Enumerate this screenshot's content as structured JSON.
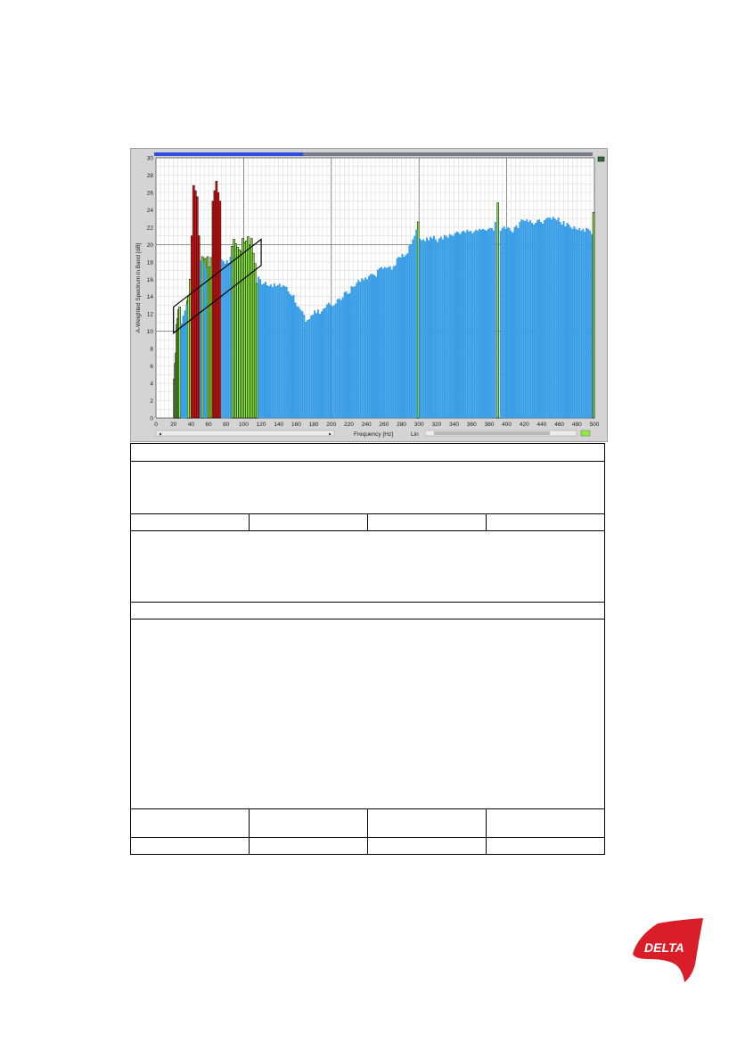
{
  "window": {
    "progress": 0.34,
    "scroll_left_arrow": "◂",
    "scroll_right_arrow": "▸",
    "scale_mode": "Lin",
    "colors": {
      "progress_fill": "#2c4ee0",
      "progress_track": "#7a7a8c",
      "band_normal": "#3a9ee6",
      "band_tonal": "#8ef03a",
      "band_prominent": "#e01010",
      "background": "#d4d4d4"
    }
  },
  "chart_data": {
    "type": "bar",
    "xlabel": "Frequency [Hz]",
    "ylabel": "A-Weighted Spectrum in Band [dB]",
    "xlim": [
      0,
      500
    ],
    "ylim": [
      0,
      30
    ],
    "x_ticks": [
      0,
      20,
      40,
      60,
      80,
      100,
      120,
      140,
      160,
      180,
      200,
      220,
      240,
      260,
      280,
      300,
      320,
      340,
      360,
      380,
      400,
      420,
      440,
      460,
      480,
      500
    ],
    "y_ticks": [
      0,
      2,
      4,
      6,
      8,
      10,
      12,
      14,
      16,
      18,
      20,
      22,
      24,
      26,
      28,
      30
    ],
    "grid": true,
    "series": [
      {
        "color": "#8ef03a",
        "points": [
          [
            20,
            4.5
          ],
          [
            21,
            6.3
          ],
          [
            22,
            7.5
          ],
          [
            23,
            10.8
          ],
          [
            24,
            11.5
          ],
          [
            25,
            12.5
          ],
          [
            26,
            12.8
          ],
          [
            35,
            13.5
          ],
          [
            36,
            14
          ],
          [
            38,
            16
          ],
          [
            52,
            18.6
          ],
          [
            55,
            18.4
          ],
          [
            58,
            18.6
          ],
          [
            60,
            17.4
          ],
          [
            62,
            18.5
          ],
          [
            86,
            19.8
          ],
          [
            88,
            20.6
          ],
          [
            90,
            20.1
          ],
          [
            92,
            19.7
          ],
          [
            94,
            19.4
          ],
          [
            96,
            19.2
          ],
          [
            98,
            20.7
          ],
          [
            100,
            20.2
          ],
          [
            102,
            20.4
          ],
          [
            104,
            20.9
          ],
          [
            106,
            19.9
          ],
          [
            108,
            20.7
          ],
          [
            110,
            19
          ],
          [
            112,
            17.8
          ],
          [
            114,
            15.5
          ],
          [
            298,
            22.6
          ],
          [
            389,
            24.8
          ]
        ]
      },
      {
        "color": "#e01010",
        "points": [
          [
            40,
            21
          ],
          [
            42,
            26.8
          ],
          [
            44,
            26.2
          ],
          [
            46,
            25.5
          ],
          [
            48,
            21
          ],
          [
            64,
            25
          ],
          [
            66,
            26.2
          ],
          [
            68,
            27.3
          ],
          [
            70,
            26
          ],
          [
            72,
            25
          ]
        ]
      },
      {
        "color": "#3a9ee6",
        "points": [
          [
            28,
            10.9
          ],
          [
            30,
            11.8
          ],
          [
            32,
            12.4
          ],
          [
            34,
            13.1
          ],
          [
            50,
            18.2
          ],
          [
            54,
            17.9
          ],
          [
            56,
            17.2
          ],
          [
            74,
            18.3
          ],
          [
            76,
            18.1
          ],
          [
            78,
            17.8
          ],
          [
            80,
            18.2
          ],
          [
            82,
            17.9
          ],
          [
            84,
            18.6
          ],
          [
            116,
            16.3
          ],
          [
            118,
            16
          ],
          [
            120,
            15.4
          ],
          [
            122,
            15.5
          ],
          [
            124,
            15.7
          ],
          [
            126,
            15.3
          ],
          [
            128,
            15.2
          ],
          [
            130,
            15.4
          ],
          [
            132,
            15.1
          ],
          [
            134,
            15.5
          ],
          [
            136,
            15.2
          ],
          [
            138,
            15.3
          ],
          [
            140,
            15.5
          ],
          [
            142,
            15.1
          ],
          [
            144,
            15.3
          ],
          [
            146,
            15.2
          ],
          [
            148,
            15.1
          ],
          [
            150,
            14.6
          ],
          [
            152,
            14.3
          ],
          [
            154,
            14.1
          ],
          [
            156,
            14.2
          ],
          [
            158,
            13.3
          ],
          [
            160,
            12.9
          ],
          [
            162,
            12.8
          ],
          [
            164,
            12.5
          ],
          [
            166,
            12.3
          ],
          [
            168,
            11.9
          ],
          [
            170,
            11.1
          ],
          [
            172,
            11.3
          ],
          [
            174,
            11.4
          ],
          [
            176,
            11.8
          ],
          [
            178,
            11.9
          ],
          [
            180,
            12.4
          ],
          [
            182,
            12.1
          ],
          [
            184,
            12.5
          ],
          [
            186,
            12
          ],
          [
            188,
            12.3
          ],
          [
            190,
            12.6
          ],
          [
            192,
            12.7
          ],
          [
            194,
            13.1
          ],
          [
            196,
            13.3
          ],
          [
            198,
            13.1
          ],
          [
            200,
            12.9
          ],
          [
            202,
            13
          ],
          [
            204,
            13.2
          ],
          [
            206,
            13.7
          ],
          [
            208,
            13.8
          ],
          [
            210,
            13.6
          ],
          [
            212,
            13.9
          ],
          [
            214,
            14.5
          ],
          [
            216,
            14.6
          ],
          [
            218,
            14.3
          ],
          [
            220,
            14.4
          ],
          [
            222,
            15.2
          ],
          [
            224,
            15.1
          ],
          [
            226,
            15.2
          ],
          [
            228,
            15.6
          ],
          [
            230,
            15.9
          ],
          [
            232,
            15.7
          ],
          [
            234,
            16.1
          ],
          [
            236,
            15.9
          ],
          [
            238,
            16.2
          ],
          [
            240,
            16
          ],
          [
            242,
            16.4
          ],
          [
            244,
            16.6
          ],
          [
            246,
            16.6
          ],
          [
            248,
            16.5
          ],
          [
            250,
            16.3
          ],
          [
            252,
            17.1
          ],
          [
            254,
            17.3
          ],
          [
            256,
            17.4
          ],
          [
            258,
            17.2
          ],
          [
            260,
            17.4
          ],
          [
            262,
            17.3
          ],
          [
            264,
            17.4
          ],
          [
            266,
            17.5
          ],
          [
            268,
            17.1
          ],
          [
            270,
            17.5
          ],
          [
            272,
            17.6
          ],
          [
            274,
            18.4
          ],
          [
            276,
            18.6
          ],
          [
            278,
            18.5
          ],
          [
            280,
            18.9
          ],
          [
            282,
            18.6
          ],
          [
            284,
            18.8
          ],
          [
            286,
            19
          ],
          [
            288,
            19.9
          ],
          [
            290,
            20
          ],
          [
            292,
            20.6
          ],
          [
            294,
            21
          ],
          [
            296,
            21.7
          ],
          [
            300,
            20.7
          ],
          [
            302,
            20.5
          ],
          [
            304,
            20.6
          ],
          [
            306,
            20.4
          ],
          [
            308,
            20.8
          ],
          [
            310,
            20.5
          ],
          [
            312,
            20.9
          ],
          [
            314,
            20.7
          ],
          [
            316,
            21
          ],
          [
            318,
            20.6
          ],
          [
            320,
            20.3
          ],
          [
            322,
            20.7
          ],
          [
            324,
            20.9
          ],
          [
            326,
            20.6
          ],
          [
            328,
            21.1
          ],
          [
            330,
            21
          ],
          [
            332,
            20.8
          ],
          [
            334,
            21.2
          ],
          [
            336,
            21.1
          ],
          [
            338,
            21
          ],
          [
            340,
            21.3
          ],
          [
            342,
            21.5
          ],
          [
            344,
            21.4
          ],
          [
            346,
            21.2
          ],
          [
            348,
            21.5
          ],
          [
            350,
            21.6
          ],
          [
            352,
            21.4
          ],
          [
            354,
            21.7
          ],
          [
            356,
            21.5
          ],
          [
            358,
            21.6
          ],
          [
            360,
            21.3
          ],
          [
            362,
            21.5
          ],
          [
            364,
            21.7
          ],
          [
            366,
            21.6
          ],
          [
            368,
            21.8
          ],
          [
            370,
            21.7
          ],
          [
            372,
            21.8
          ],
          [
            374,
            21.7
          ],
          [
            376,
            21.6
          ],
          [
            378,
            21.8
          ],
          [
            380,
            21.9
          ],
          [
            382,
            21.9
          ],
          [
            384,
            21.6
          ],
          [
            386,
            22.6
          ],
          [
            392,
            21.6
          ],
          [
            394,
            21.9
          ],
          [
            396,
            22.1
          ],
          [
            398,
            21.8
          ],
          [
            400,
            22
          ],
          [
            402,
            21.9
          ],
          [
            404,
            21.6
          ],
          [
            406,
            21.4
          ],
          [
            408,
            22
          ],
          [
            410,
            22.2
          ],
          [
            412,
            21.9
          ],
          [
            414,
            22.6
          ],
          [
            416,
            22.9
          ],
          [
            418,
            22.8
          ],
          [
            420,
            22.7
          ],
          [
            422,
            22.9
          ],
          [
            424,
            22.6
          ],
          [
            426,
            22.8
          ],
          [
            428,
            22.5
          ],
          [
            430,
            22.3
          ],
          [
            432,
            22.5
          ],
          [
            434,
            22.8
          ],
          [
            436,
            22.9
          ],
          [
            438,
            22.6
          ],
          [
            440,
            22.4
          ],
          [
            442,
            22.8
          ],
          [
            444,
            23
          ],
          [
            446,
            23.1
          ],
          [
            448,
            23.1
          ],
          [
            450,
            22.9
          ],
          [
            452,
            23.2
          ],
          [
            454,
            23
          ],
          [
            456,
            22.8
          ],
          [
            458,
            23.1
          ],
          [
            460,
            22.6
          ],
          [
            462,
            22.3
          ],
          [
            464,
            22.7
          ],
          [
            466,
            22.1
          ],
          [
            468,
            22.5
          ],
          [
            470,
            22.3
          ],
          [
            472,
            22
          ],
          [
            474,
            21.8
          ],
          [
            476,
            22.1
          ],
          [
            478,
            21.8
          ],
          [
            480,
            21.7
          ],
          [
            482,
            21.9
          ],
          [
            484,
            21.6
          ],
          [
            486,
            21.8
          ],
          [
            488,
            21.5
          ],
          [
            490,
            21.9
          ],
          [
            492,
            21.8
          ],
          [
            494,
            21.6
          ],
          [
            496,
            21.2
          ]
        ]
      },
      {
        "color": "#8ef03a",
        "points": [
          [
            498,
            23.7
          ]
        ]
      }
    ],
    "annotation_band": {
      "x": [
        20,
        120
      ],
      "y_upper": [
        12.8,
        20.6
      ],
      "y_lower": [
        9.8,
        17.6
      ]
    }
  },
  "table": {
    "rows": [
      {
        "cols": 1
      },
      {
        "cols": 1
      },
      {
        "cols": 4
      },
      {
        "cols": 1
      },
      {
        "cols": 1
      },
      {
        "cols": 1
      },
      {
        "cols": 4
      },
      {
        "cols": 4
      }
    ]
  },
  "logo": {
    "text": "DELTA",
    "color": "#d91e2a"
  }
}
